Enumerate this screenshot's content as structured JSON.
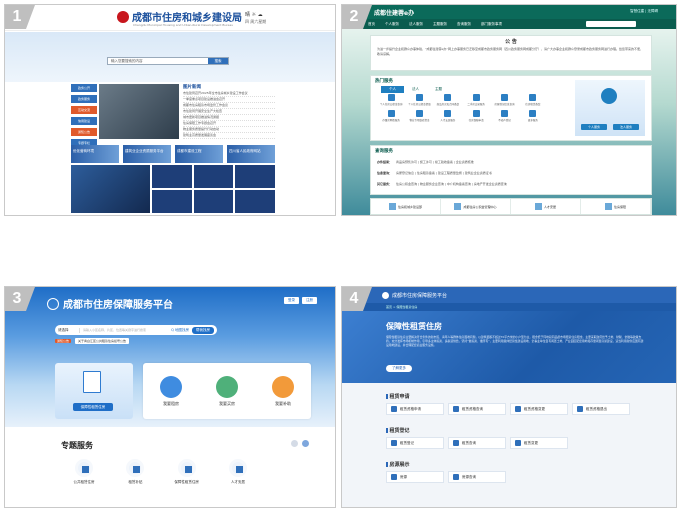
{
  "panels": [
    {
      "badge": "1"
    },
    {
      "badge": "2"
    },
    {
      "badge": "3"
    },
    {
      "badge": "4"
    }
  ],
  "p1": {
    "title": "成都市住房和城乡建设局",
    "subtitle": "Chengdu Municipal Housing and Urban-Rural Development Bureau",
    "weather": "晴  ☼  ☁",
    "weather_sub": "四  周六星期",
    "search_text": "输入您要搜索的内容",
    "search_button": "搜索",
    "left_nav": [
      "政务公开",
      "政务服务",
      "互动交流",
      "信用建设",
      "通知公告",
      "专题专栏"
    ],
    "left_nav_colors": [
      "#2f6fba",
      "#2f6fba",
      "#e05a2b",
      "#2f6fba",
      "#e05a2b",
      "#2f6fba"
    ],
    "news_title": "图片新闻",
    "news": [
      "市住建局召开2025年全市住房城乡建设工作会议",
      "一季度重点项目建设推进会召开",
      "成都市住房租赁市场监管工作会议",
      "市住建局开展安全生产大检查",
      "城市更新项目推进情况通报",
      "住房保障工作专题会召开",
      "物业服务质量提升行动启动",
      "建筑业高质量发展座谈会"
    ],
    "banners": [
      "优化营商环境",
      "建筑业企业资质服务平台",
      "成都市建设工程",
      "四川省人民政府网站"
    ]
  },
  "p2": {
    "brand": "成都住建蓉e办",
    "top_link": "智慧住建 | 无障碍",
    "nav": [
      "首页",
      "个人服务",
      "法人服务",
      "主题服务",
      "查询服务",
      "部门服务事项"
    ],
    "notice_title": "公  告",
    "notice_body": "为进一步提升企业和群众办事体验，“成都住建蓉e办”网上办事服务已迁移至成都市政务服务网（四川政务服务网成都分厅），请广大办事企业和群众登录成都市政务服务网进行办理。给您带来的不便，敬请谅解。",
    "hot_title": "热门服务",
    "tabs": [
      "个人",
      "法人",
      "主题"
    ],
    "hot_items": [
      "个人住房公积金查询",
      "个人住房公积金提取",
      "商品房买卖合同备案",
      "二手房交易服务",
      "房屋登记信息查询",
      "住房租赁备案",
      "存量房网签服务",
      "物业专项维修资金",
      "人才安居服务",
      "住房保障申请",
      "不动产登记",
      "更多服务"
    ],
    "promo_buttons": [
      "个人服务",
      "法人服务"
    ],
    "query_title": "查询服务",
    "query_rows": [
      {
        "label": "办件结果：",
        "items": "商品房预售许可 | 施工许可 | 竣工验收备案 | 企业资质核准"
      },
      {
        "label": "信息查询：",
        "items": "房屋登记信息 | 住房租赁备案 | 建设工程质量监督 | 建筑业企业资质证书"
      },
      {
        "label": "其它服务：",
        "items": "住房公积金查询 | 物业服务企业查询 | 中介机构备案查询 | 房地产开发企业资质查询"
      }
    ],
    "links": [
      "住房和城乡建设部",
      "成都住房公积金管理中心",
      "人才安居",
      "住房保障"
    ]
  },
  "p3": {
    "title": "成都市住房保障服务平台",
    "top_links": [
      "登录",
      "注册"
    ],
    "search_select": "请选择",
    "search_placeholder": "请输入小区名称、片区、位置等关键字进行搜索",
    "search_button": "Q 地图找房",
    "search_help": "帮我找房",
    "tip_tag": "通知公告",
    "tip_text": "关于青白江区公共租赁住房摇号公告",
    "card1_button": "保障性租赁住房",
    "circles": [
      {
        "label": "我要租房",
        "color": "#3f8ce0"
      },
      {
        "label": "我要买房",
        "color": "#4fb07a"
      },
      {
        "label": "我要补助",
        "color": "#f29a3a"
      }
    ],
    "special_title": "专题服务",
    "services": [
      "公共租赁住房",
      "租赁补贴",
      "保障性租赁住房",
      "人才安居"
    ]
  },
  "p4": {
    "title": "成都市住房保障服务平台",
    "breadcrumb": "首页 > 保障性租赁住房",
    "hero_title": "保障性租赁住房",
    "hero_text": "保障性租赁住房主要解决符合条件的新市民、青年人等群体住房困难问题，以建筑面积不超过70平方米的小户型为主，租金低于同地段同品质市场租赁住房租金。主要采取政府给予土地、财税、金融等政策支持，充分发挥市场机制作用，引导多主体投资、多渠道供给，坚持“谁投资、谁所有”，主要利用集体经营性建设用地、企事业单位自有闲置土地、产业园区配套用地和存量闲置房屋建设，适当利用新供应国有建设用地建设，并合理配套商业服务设施。",
    "hero_button": "了解更多",
    "sections": [
      {
        "title": "租赁申请",
        "items": [
          "租赁资格申请",
          "租赁资格查询",
          "租赁资格变更",
          "租赁资格退出"
        ]
      },
      {
        "title": "租赁登记",
        "items": [
          "租赁登记",
          "租赁查询",
          "租赁变更"
        ]
      },
      {
        "title": "房源展示",
        "items": [
          "房源",
          "房源查询"
        ]
      }
    ]
  }
}
